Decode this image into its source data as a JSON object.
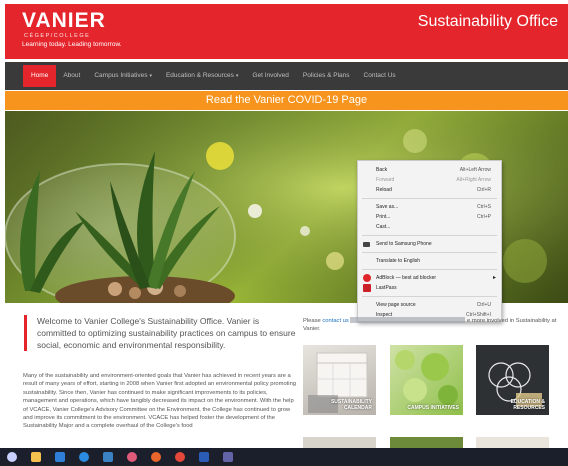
{
  "header": {
    "brand_name": "VANIER",
    "brand_sub": "CÉGEP/COLLEGE",
    "tagline": "Learning today. Leading tomorrow.",
    "office_title": "Sustainability Office"
  },
  "nav": {
    "items": [
      {
        "label": "Home",
        "dropdown": false
      },
      {
        "label": "About",
        "dropdown": false
      },
      {
        "label": "Campus Initiatives",
        "dropdown": true
      },
      {
        "label": "Education & Resources",
        "dropdown": true
      },
      {
        "label": "Get Involved",
        "dropdown": false
      },
      {
        "label": "Policies & Plans",
        "dropdown": false
      },
      {
        "label": "Contact Us",
        "dropdown": false
      }
    ],
    "caret": "▾"
  },
  "banner": {
    "text": "Read the Vanier COVID-19 Page"
  },
  "context_menu": {
    "items": [
      {
        "label": "Back",
        "shortcut": "Alt+Left Arrow",
        "disabled": false
      },
      {
        "label": "Forward",
        "shortcut": "Alt+Right Arrow",
        "disabled": true
      },
      {
        "label": "Reload",
        "shortcut": "Ctrl+R",
        "disabled": false
      },
      {
        "label": "Save as...",
        "shortcut": "Ctrl+S",
        "disabled": false
      },
      {
        "label": "Print...",
        "shortcut": "Ctrl+P",
        "disabled": false
      },
      {
        "label": "Cast...",
        "shortcut": "",
        "disabled": false
      },
      {
        "label": "Send to Samsung Phone",
        "shortcut": "",
        "disabled": false
      },
      {
        "label": "Translate to English",
        "shortcut": "",
        "disabled": false
      },
      {
        "label": "AdBlock — best ad blocker",
        "shortcut": "",
        "disabled": false
      },
      {
        "label": "LastPass",
        "shortcut": "",
        "disabled": false
      },
      {
        "label": "View page source",
        "shortcut": "Ctrl+U",
        "disabled": false
      },
      {
        "label": "Inspect",
        "shortcut": "Ctrl+Shift+I",
        "disabled": false
      }
    ],
    "submenu_arrow": "▸"
  },
  "content": {
    "welcome": "Welcome to Vanier College's Sustainability Office. Vanier is committed to optimizing sustainability practices on campus to ensure social, economic and environmental responsibility.",
    "body": "Many of the sustainability and environment-oriented goals that Vanier has achieved in recent years are a result of many years of effort, starting in 2008 when Vanier first adopted an environmental policy promoting sustainability. Since then, Vanier has continued to make significant improvements to its policies, management and operations, which have tangibly decreased its impact on the environment. With the help of VCACE, Vanier College's Advisory Committee on the Environment, the College has continued to grow and improve its commitment to the environment. VCACE has helped foster the development of the Sustainability Major and a complete overhaul of the College's food",
    "contact_prefix": "Please",
    "contact_link": "contact us",
    "contact_suffix": "e more involved in Sustainability at Vanier.",
    "tiles": [
      {
        "label": "SUSTAINABILITY CALENDAR"
      },
      {
        "label": "CAMPUS INITIATIVES"
      },
      {
        "label": "EDUCATION & RESOURCES"
      }
    ]
  },
  "taskbar": {
    "icons": [
      {
        "name": "start-icon",
        "color": "#c8d1ff"
      },
      {
        "name": "explorer-icon",
        "color": "#f2c14e"
      },
      {
        "name": "mail-icon",
        "color": "#2f7fd8"
      },
      {
        "name": "edge-icon",
        "color": "#2b8be0"
      },
      {
        "name": "store-icon",
        "color": "#3b82c4"
      },
      {
        "name": "app-icon",
        "color": "#e05a7a"
      },
      {
        "name": "firefox-icon",
        "color": "#e8662c"
      },
      {
        "name": "chrome-icon",
        "color": "#e6473b"
      },
      {
        "name": "word-icon",
        "color": "#2a5cb8"
      },
      {
        "name": "teams-icon",
        "color": "#6264a7"
      }
    ]
  },
  "colors": {
    "brand_red": "#e4262c",
    "nav_dark": "#3a3a3a",
    "banner_orange": "#f7941d",
    "link_blue": "#1a6fc0"
  }
}
